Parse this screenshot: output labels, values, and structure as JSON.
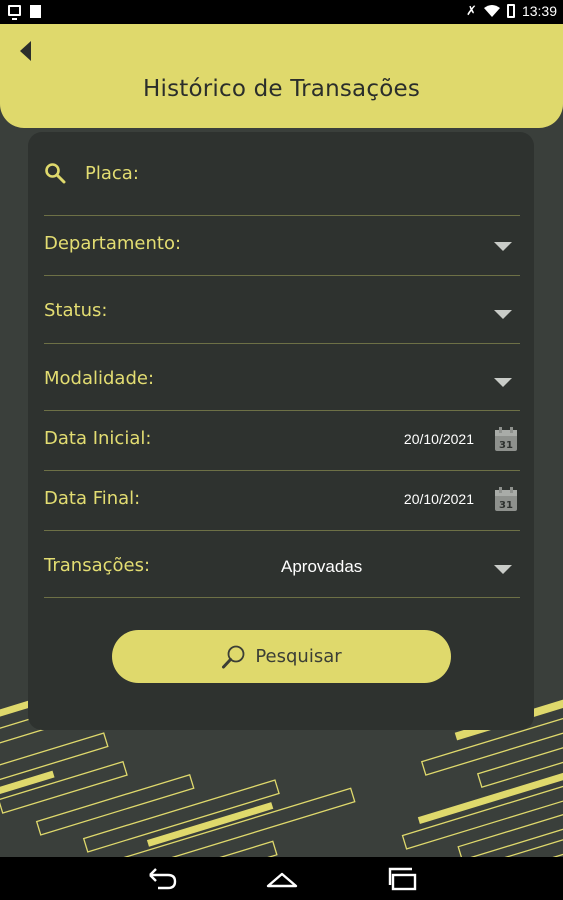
{
  "status_bar": {
    "time": "13:39"
  },
  "header": {
    "title": "Histórico de Transações"
  },
  "form": {
    "placa_label": "Placa:",
    "departamento_label": "Departamento:",
    "status_label": "Status:",
    "modalidade_label": "Modalidade:",
    "data_inicial_label": "Data Inicial:",
    "data_inicial_value": "20/10/2021",
    "data_final_label": "Data Final:",
    "data_final_value": "20/10/2021",
    "calendar_day": "31",
    "transacoes_label": "Transações:",
    "transacoes_value": "Aprovadas",
    "search_button": "Pesquisar"
  },
  "icons": {
    "back": "back-arrow-icon",
    "search": "search-icon",
    "dropdown": "chevron-down-icon",
    "calendar": "calendar-icon",
    "nav_back": "nav-back-icon",
    "nav_home": "nav-home-icon",
    "nav_recents": "nav-recents-icon"
  },
  "colors": {
    "accent": "#dfd96c",
    "background": "#3a3f3b",
    "card": "#2e322f",
    "label_text": "#e3dd72"
  }
}
